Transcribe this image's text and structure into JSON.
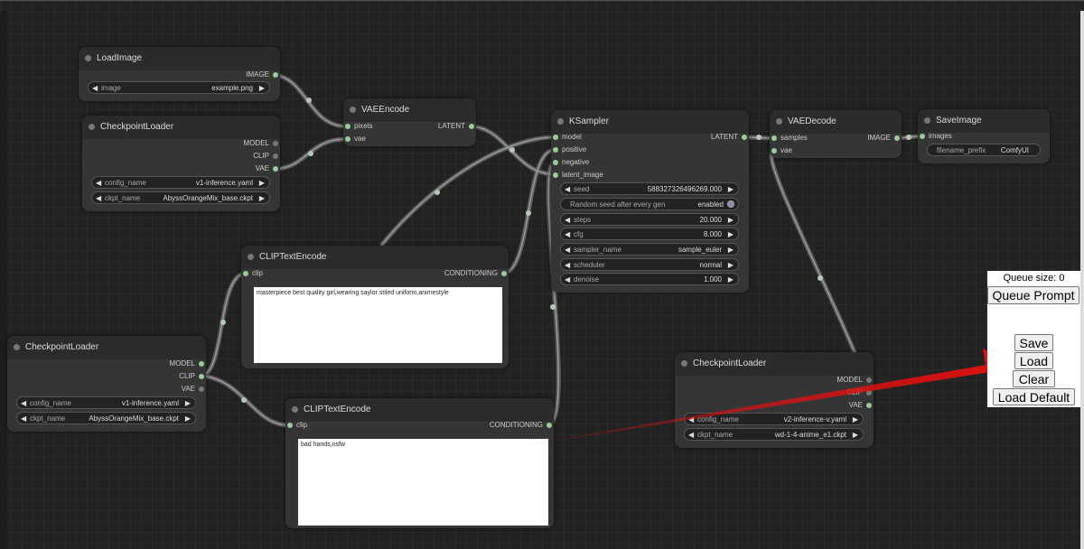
{
  "nodes": {
    "load_image": {
      "title": "LoadImage",
      "output": "IMAGE",
      "image_label": "image",
      "image_value": "example.png"
    },
    "checkpoint_loader_1": {
      "title": "CheckpointLoader",
      "outputs": [
        "MODEL",
        "CLIP",
        "VAE"
      ],
      "config_label": "config_name",
      "config_value": "v1-inference.yaml",
      "ckpt_label": "ckpt_name",
      "ckpt_value": "AbyssOrangeMix_base.ckpt"
    },
    "vae_encode": {
      "title": "VAEEncode",
      "inputs": [
        "pixels",
        "vae"
      ],
      "output": "LATENT"
    },
    "ksampler": {
      "title": "KSampler",
      "inputs": [
        "model",
        "positive",
        "negative",
        "latent_image"
      ],
      "output": "LATENT",
      "seed_label": "seed",
      "seed_value": "588327326496269.000",
      "random_label": "Random seed after every gen",
      "random_value": "enabled",
      "steps_label": "steps",
      "steps_value": "20.000",
      "cfg_label": "cfg",
      "cfg_value": "8.000",
      "sampler_label": "sampler_name",
      "sampler_value": "sample_euler",
      "scheduler_label": "scheduler",
      "scheduler_value": "normal",
      "denoise_label": "denoise",
      "denoise_value": "1.000"
    },
    "vae_decode": {
      "title": "VAEDecode",
      "inputs": [
        "samples",
        "vae"
      ],
      "output": "IMAGE"
    },
    "save_image": {
      "title": "SaveImage",
      "input": "images",
      "prefix_label": "filename_prefix",
      "prefix_value": "ComfyUI"
    },
    "clip_text_encode_pos": {
      "title": "CLIPTextEncode",
      "input": "clip",
      "output": "CONDITIONING",
      "text": "masterpiece best quality girl,wearing saylor stiled uniform,animestyle"
    },
    "checkpoint_loader_2": {
      "title": "CheckpointLoader",
      "outputs": [
        "MODEL",
        "CLIP",
        "VAE"
      ],
      "config_label": "config_name",
      "config_value": "v1-inference.yaml",
      "ckpt_label": "ckpt_name",
      "ckpt_value": "AbyssOrangeMix_base.ckpt"
    },
    "clip_text_encode_neg": {
      "title": "CLIPTextEncode",
      "input": "clip",
      "output": "CONDITIONING",
      "text": "bad hands,nsfw"
    },
    "checkpoint_loader_3": {
      "title": "CheckpointLoader",
      "outputs": [
        "MODEL",
        "CLIP",
        "VAE"
      ],
      "config_label": "config_name",
      "config_value": "v2-inference-v.yaml",
      "ckpt_label": "ckpt_name",
      "ckpt_value": "wd-1-4-anime_e1.ckpt"
    }
  },
  "menu": {
    "queue_size": "Queue size: 0",
    "queue_prompt": "Queue Prompt",
    "save": "Save",
    "load": "Load",
    "clear": "Clear",
    "load_default": "Load Default"
  },
  "colors": {
    "canvas": "#222222",
    "node": "#353535",
    "link": "#aaaaaa",
    "port": "#99cc99",
    "annotation_arrow": "#e01010"
  },
  "icons": {
    "arrow_left": "◀",
    "arrow_right": "▶"
  }
}
